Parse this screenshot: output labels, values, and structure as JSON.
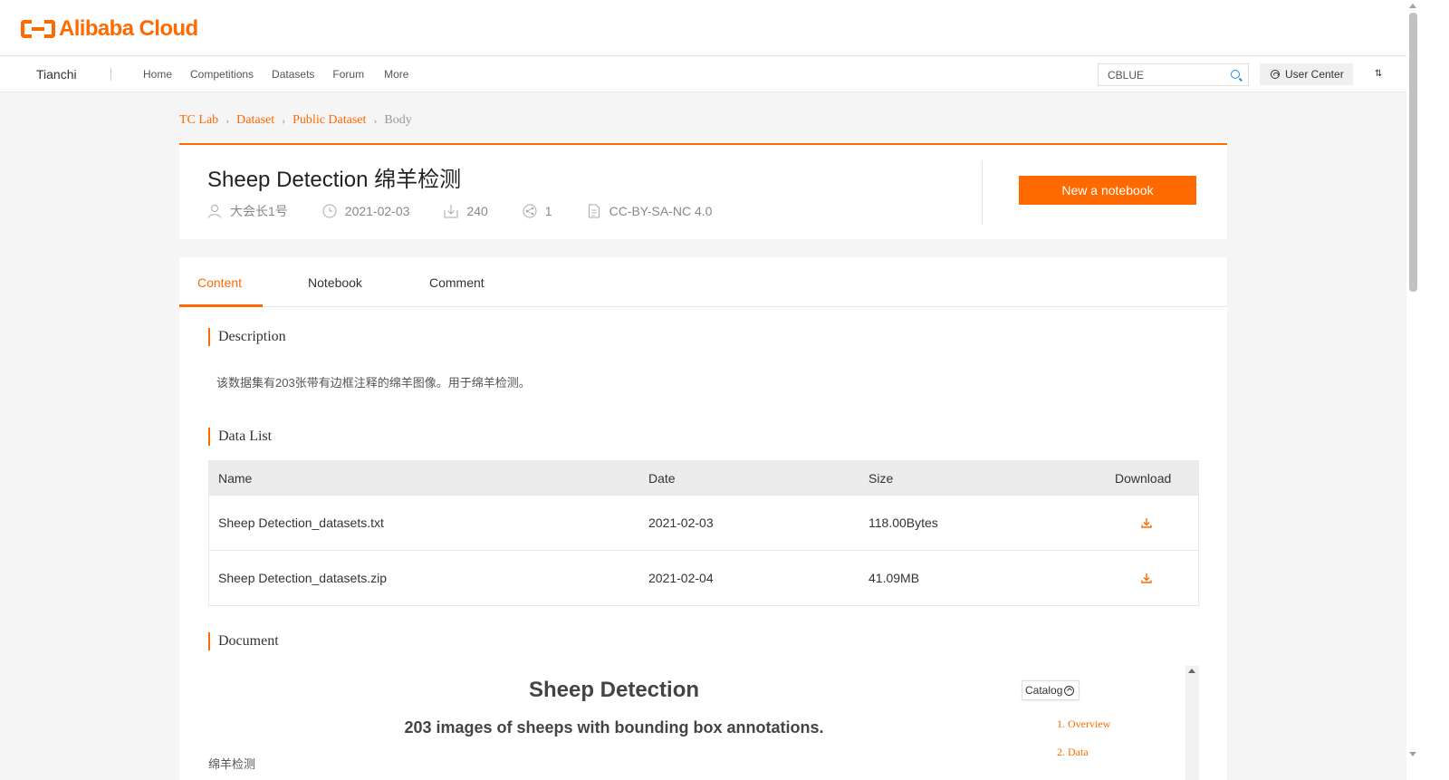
{
  "brand": {
    "logo_text": "Alibaba Cloud",
    "accent_color": "#ff6a00"
  },
  "nav": {
    "brand": "Tianchi",
    "links": [
      "Home",
      "Competitions",
      "Datasets",
      "Forum",
      "More"
    ],
    "search_value": "CBLUE",
    "user_center": "User Center"
  },
  "breadcrumb": [
    "TC Lab",
    "Dataset",
    "Public Dataset",
    "Body"
  ],
  "dataset": {
    "title": "Sheep Detection 绵羊检测",
    "author": "大会长1号",
    "date": "2021-02-03",
    "downloads": "240",
    "shares": "1",
    "license": "CC-BY-SA-NC 4.0",
    "new_notebook": "New a notebook"
  },
  "tabs": [
    "Content",
    "Notebook",
    "Comment"
  ],
  "sections": {
    "description": "Description",
    "description_text": "该数据集有203张带有边框注释的绵羊图像。用于绵羊检测。",
    "data_list": "Data List",
    "document": "Document"
  },
  "table": {
    "headers": [
      "Name",
      "Date",
      "Size",
      "Download"
    ],
    "rows": [
      {
        "name": "Sheep Detection_datasets.txt",
        "date": "2021-02-03",
        "size": "118.00Bytes"
      },
      {
        "name": "Sheep Detection_datasets.zip",
        "date": "2021-02-04",
        "size": "41.09MB"
      }
    ]
  },
  "document": {
    "title": "Sheep Detection",
    "subtitle": "203 images of sheeps with bounding box annotations.",
    "cn_text": "绵羊检测",
    "catalog": "Catalog",
    "toc": [
      "1. Overview",
      "2. Data"
    ]
  }
}
